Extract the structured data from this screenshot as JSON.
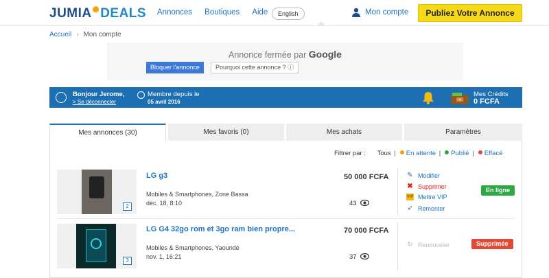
{
  "header": {
    "logo_main": "JUMIA",
    "logo_sub": "DEALS",
    "nav": [
      "Annonces",
      "Boutiques",
      "Aide"
    ],
    "lang": "English",
    "account": "Mon compte",
    "publish": "Publiez Votre Annonce"
  },
  "breadcrumb": {
    "home": "Accueil",
    "current": "Mon compte"
  },
  "ad": {
    "closed_text": "Annonce fermée par",
    "closed_brand": "Google",
    "block_btn": "Bloquer l'annonce",
    "why_btn": "Pourquoi cette annonce ? ⓘ"
  },
  "userbar": {
    "greeting": "Bonjour Jerome,",
    "logout": "> Se déconnecter",
    "member_label": "Membre depuis le",
    "member_date": "05 avril 2016",
    "credits_label": "Mes Crédits",
    "credits_value": "0 FCFA"
  },
  "tabs": [
    "Mes annonces (30)",
    "Mes favoris (0)",
    "Mes achats",
    "Paramètres"
  ],
  "filter": {
    "label": "Filtrer par :",
    "all": "Tous",
    "pending": "En attente",
    "published": "Publié",
    "deleted": "Effacé"
  },
  "listings": [
    {
      "title": "LG g3",
      "category": "Mobiles & Smartphones, Zone Bassa",
      "date": "déc. 18, 8:10",
      "price": "50 000 FCFA",
      "views": "43",
      "photos": "2",
      "status": "En ligne",
      "actions": [
        "Modifier",
        "Supprimer",
        "Mettre VIP",
        "Remonter"
      ]
    },
    {
      "title": "LG G4 32go rom et 3go ram bien propre...",
      "category": "Mobiles & Smartphones, Yaoundé",
      "date": "nov. 1, 16:21",
      "price": "70 000 FCFA",
      "views": "37",
      "photos": "3",
      "status": "Supprimée",
      "actions": [
        "Renouveler"
      ]
    }
  ],
  "colors": {
    "brand_blue": "#1d6fb3",
    "link_blue": "#1e73be",
    "publish_yellow": "#f7d91b",
    "online_green": "#2da843",
    "deleted_red": "#e04a36",
    "pending_orange": "#f0a000"
  }
}
